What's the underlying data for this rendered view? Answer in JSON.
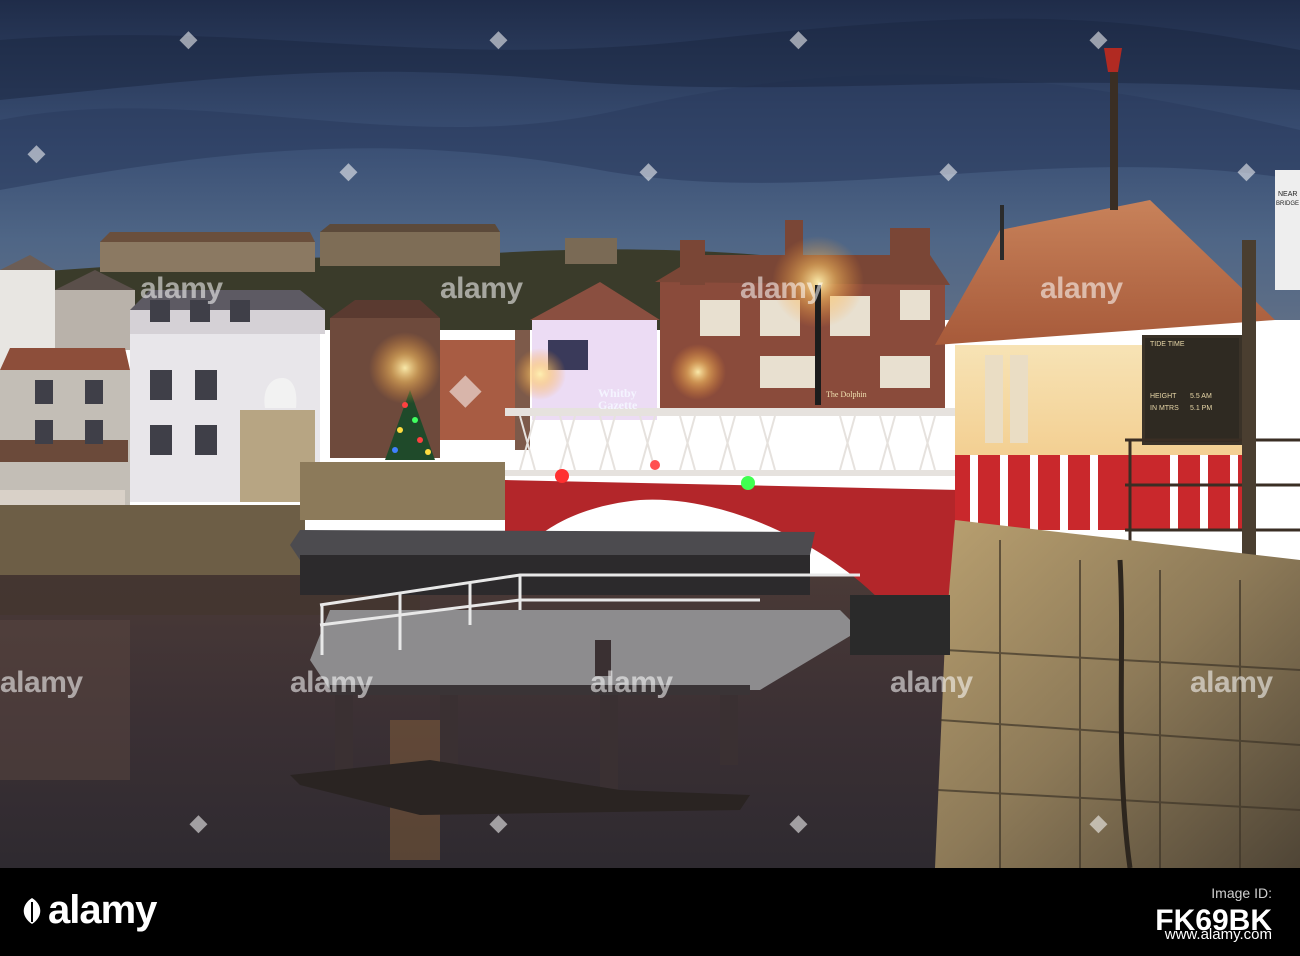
{
  "image": {
    "scene": "Whitby swing bridge at dusk",
    "shop_sign": [
      "Whitby",
      "Gazette"
    ],
    "pub_sign": "The Dolphin",
    "tide_board": [
      "TIDE TIME",
      "HEIGHT",
      "5.5 AM",
      "IN MTRS",
      "5.1 PM"
    ],
    "bridge_sign": [
      "NEAR",
      "BRIDGE"
    ]
  },
  "watermark": {
    "text": "alamy",
    "count_note": "repeated grid"
  },
  "footer": {
    "brand": "alamy",
    "id_label": "Image ID:",
    "id_value": "FK69BK",
    "url": "www.alamy.com"
  },
  "colors": {
    "sky_top": "#23314f",
    "sky_mid": "#3f5378",
    "water": "#3c3236",
    "bridge_red": "#b8262a",
    "lamp_glow": "#ffcf73",
    "footer_bg": "#000000"
  }
}
